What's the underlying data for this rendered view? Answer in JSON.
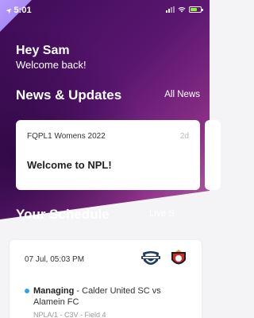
{
  "status_bar": {
    "time": "5:01"
  },
  "greeting": {
    "title": "Hey Sam",
    "subtitle": "Welcome back!"
  },
  "news": {
    "section_title": "News & Updates",
    "link_label": "All News",
    "items": [
      {
        "tag": "FQPL1 Womens 2022",
        "age": "2d",
        "headline": "Welcome to NPL!"
      }
    ]
  },
  "schedule": {
    "section_title": "Your Schedule",
    "link_label": "Live S",
    "matches": [
      {
        "datetime": "07 Jul, 05:03 PM",
        "role": "Managing",
        "teams_text": " - Calder United SC vs Alamein FC",
        "competition": "NPLA/1 - C3V - Field 4"
      }
    ]
  },
  "colors": {
    "hero_dark": "#3c0b55",
    "hero_light": "#b56aa8",
    "status_dot": "#2aa8e0"
  }
}
